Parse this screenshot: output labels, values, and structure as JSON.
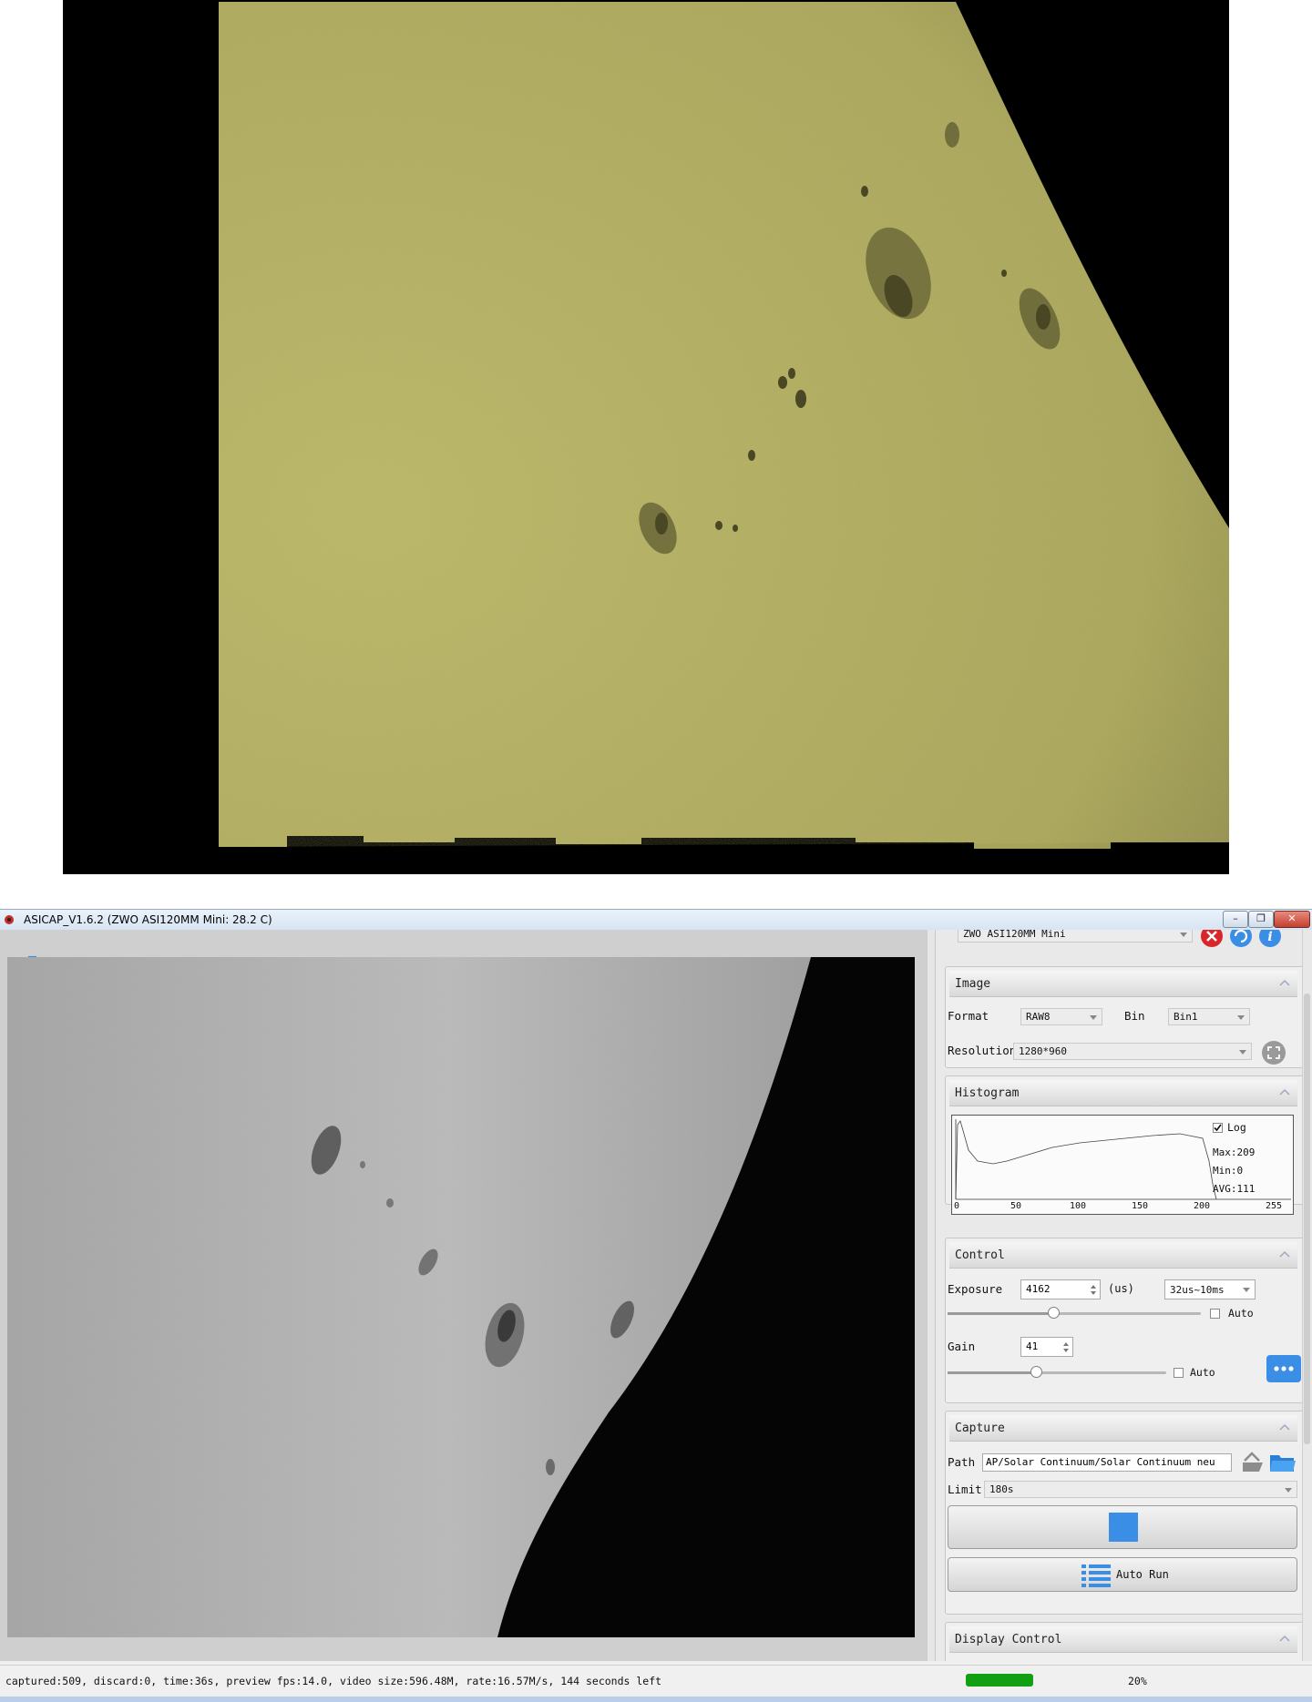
{
  "window": {
    "title": "ASICAP_V1.6.2 (ZWO ASI120MM Mini: 28.2 C)",
    "minimize_glyph": "–",
    "maximize_glyph": "❐",
    "close_glyph": "✕"
  },
  "camera": {
    "selected": "ZWO ASI120MM Mini"
  },
  "image_section": {
    "title": "Image",
    "format_label": "Format",
    "format_value": "RAW8",
    "bin_label": "Bin",
    "bin_value": "Bin1",
    "resolution_label": "Resolution",
    "resolution_value": "1280*960"
  },
  "histogram_section": {
    "title": "Histogram",
    "log_label": "Log",
    "log_checked": true,
    "max_text": "Max:209",
    "min_text": "Min:0",
    "avg_text": "AVG:111",
    "x_ticks": [
      "0",
      "50",
      "100",
      "150",
      "200",
      "255"
    ]
  },
  "control_section": {
    "title": "Control",
    "exposure_label": "Exposure",
    "exposure_value": "4162",
    "exposure_unit": "(us)",
    "exposure_range": "32us~10ms",
    "exposure_slider_fraction": 0.42,
    "exposure_auto_label": "Auto",
    "gain_label": "Gain",
    "gain_value": "41",
    "gain_slider_fraction": 0.41,
    "gain_auto_label": "Auto"
  },
  "capture_section": {
    "title": "Capture",
    "path_label": "Path",
    "path_value": "AP/Solar Continuum/Solar Continuum neu",
    "limit_label": "Limit",
    "limit_value": "180s",
    "autorun_label": "Auto Run"
  },
  "display_control": {
    "title": "Display Control"
  },
  "status": {
    "text": "captured:509, discard:0, time:36s, preview fps:14.0, video size:596.48M, rate:16.57M/s, 144 seconds left",
    "progress_text": "20%",
    "progress_fraction": 0.2
  },
  "colors": {
    "accent_blue": "#3b8ee6",
    "close_red": "#d9262b",
    "progress_green": "#11a011",
    "solar_yellow": "#b4b060"
  }
}
